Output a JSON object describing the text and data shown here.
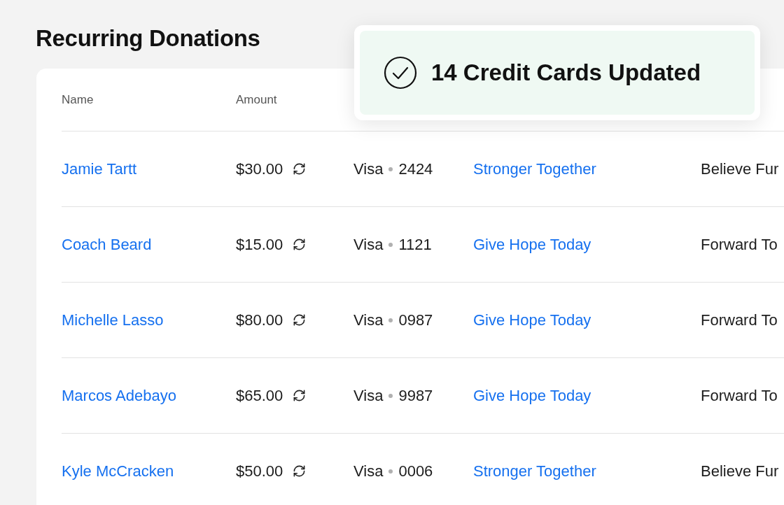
{
  "title": "Recurring Donations",
  "toast": {
    "message": "14 Credit Cards Updated"
  },
  "table": {
    "columns": [
      "Name",
      "Amount"
    ],
    "rows": [
      {
        "name": "Jamie Tartt",
        "amount": "$30.00",
        "card_brand": "Visa",
        "card_last4": "2424",
        "campaign": "Stronger Together",
        "column_5": "Believe Fur"
      },
      {
        "name": "Coach Beard",
        "amount": "$15.00",
        "card_brand": "Visa",
        "card_last4": "1121",
        "campaign": "Give Hope Today",
        "column_5": "Forward To"
      },
      {
        "name": "Michelle Lasso",
        "amount": "$80.00",
        "card_brand": "Visa",
        "card_last4": "0987",
        "campaign": "Give Hope Today",
        "column_5": "Forward To"
      },
      {
        "name": "Marcos Adebayo",
        "amount": "$65.00",
        "card_brand": "Visa",
        "card_last4": "9987",
        "campaign": "Give Hope Today",
        "column_5": "Forward To"
      },
      {
        "name": "Kyle McCracken",
        "amount": "$50.00",
        "card_brand": "Visa",
        "card_last4": "0006",
        "campaign": "Stronger Together",
        "column_5": "Believe Fur"
      }
    ]
  }
}
